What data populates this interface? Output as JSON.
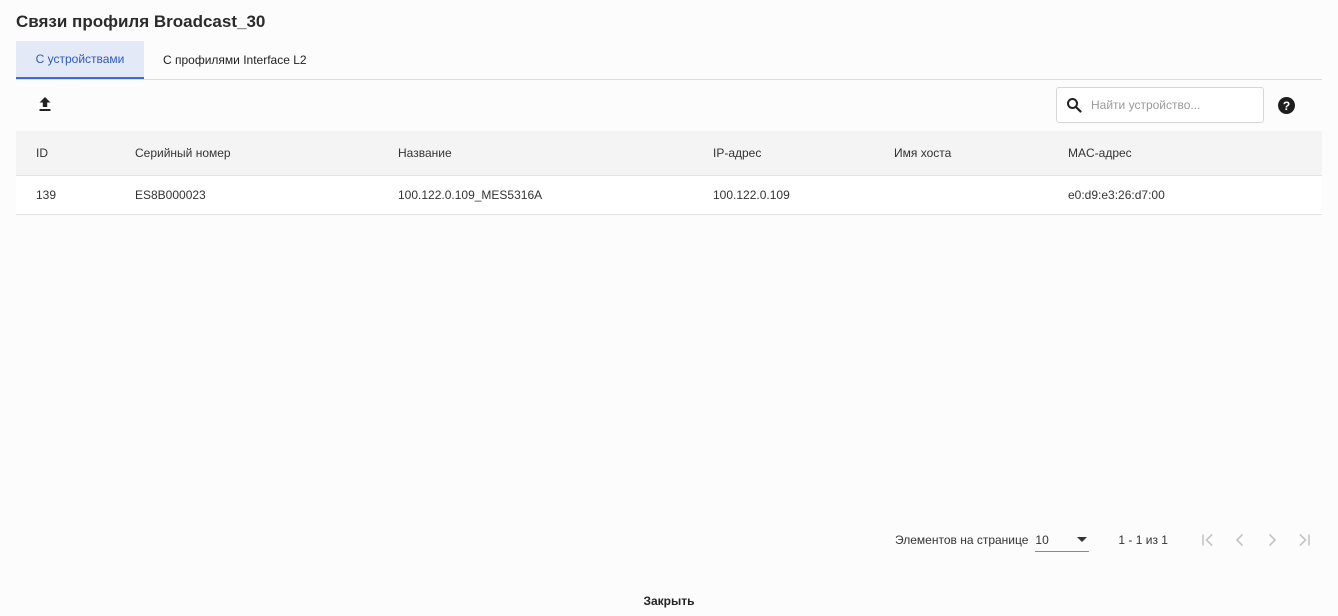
{
  "dialog": {
    "title": "Связи профиля Broadcast_30",
    "close_label": "Закрыть"
  },
  "tabs": [
    {
      "label": "С устройствами",
      "active": true
    },
    {
      "label": "С профилями Interface L2",
      "active": false
    }
  ],
  "toolbar": {
    "upload_icon": "upload-icon",
    "search_placeholder": "Найти устройство...",
    "search_value": "",
    "help_icon": "help-icon"
  },
  "table": {
    "columns": [
      "ID",
      "Серийный номер",
      "Название",
      "IP-адрес",
      "Имя хоста",
      "MAC-адрес"
    ],
    "rows": [
      [
        "139",
        "ES8B000023",
        "100.122.0.109_MES5316A",
        "100.122.0.109",
        "",
        "e0:d9:e3:26:d7:00"
      ]
    ]
  },
  "paginator": {
    "items_per_page_label": "Элементов на странице",
    "page_size": "10",
    "range_label": "1 - 1 из 1"
  },
  "colors": {
    "accent": "#3f6ad1",
    "active_tab_bg": "#e3e9f6"
  }
}
